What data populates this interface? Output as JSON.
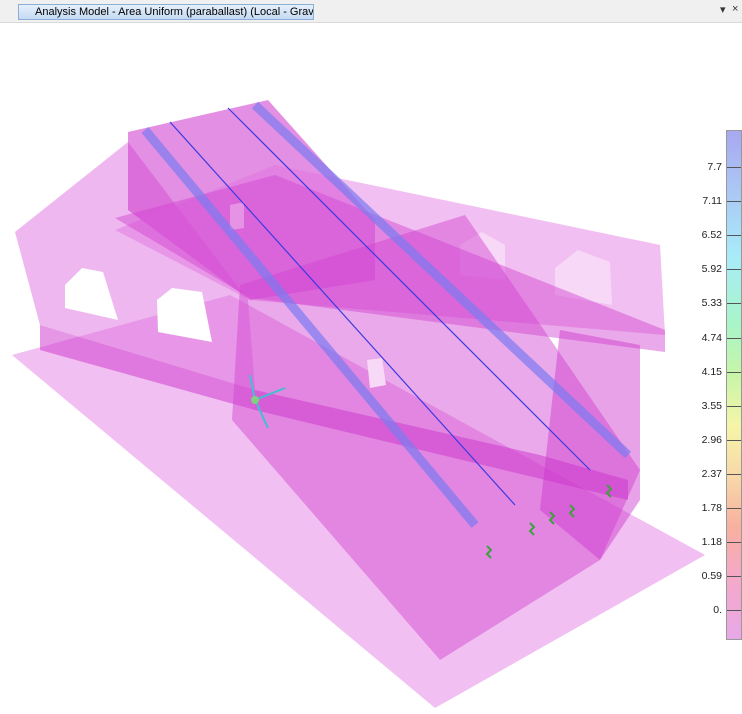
{
  "window": {
    "tab_title": "Analysis Model - Area Uniform (paraballast) (Local - Gravity)",
    "dropdown_glyph": "▾",
    "close_glyph": "×"
  },
  "legend": {
    "values": [
      "7.7",
      "7.11",
      "6.52",
      "5.92",
      "5.33",
      "4.74",
      "4.15",
      "3.55",
      "2.96",
      "2.37",
      "1.78",
      "1.18",
      "0.59",
      "0."
    ],
    "colors": {
      "top": "#a8a8f0",
      "bottom": "#e8a8e8"
    }
  },
  "model": {
    "surface_color": "#e070e0",
    "beam_color": "#8a8af0",
    "axis_color": "#40c0d0",
    "support_color": "#40a040"
  }
}
